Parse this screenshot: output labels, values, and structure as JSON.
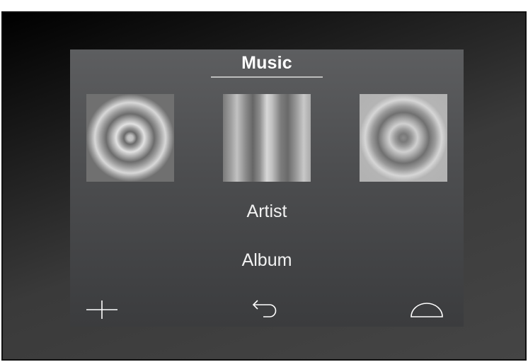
{
  "screen": {
    "title": "Music"
  },
  "covers": [
    {
      "name": "album-cover-1"
    },
    {
      "name": "album-cover-2"
    },
    {
      "name": "album-cover-3"
    }
  ],
  "menu": {
    "artist_label": "Artist",
    "album_label": "Album"
  },
  "toolbar": {
    "add_icon": "plus-icon",
    "back_icon": "back-arrow-icon",
    "home_icon": "dome-icon"
  },
  "colors": {
    "text": "#ffffff",
    "underline": "#bdbdbd",
    "panel": "#4c4d4f"
  }
}
